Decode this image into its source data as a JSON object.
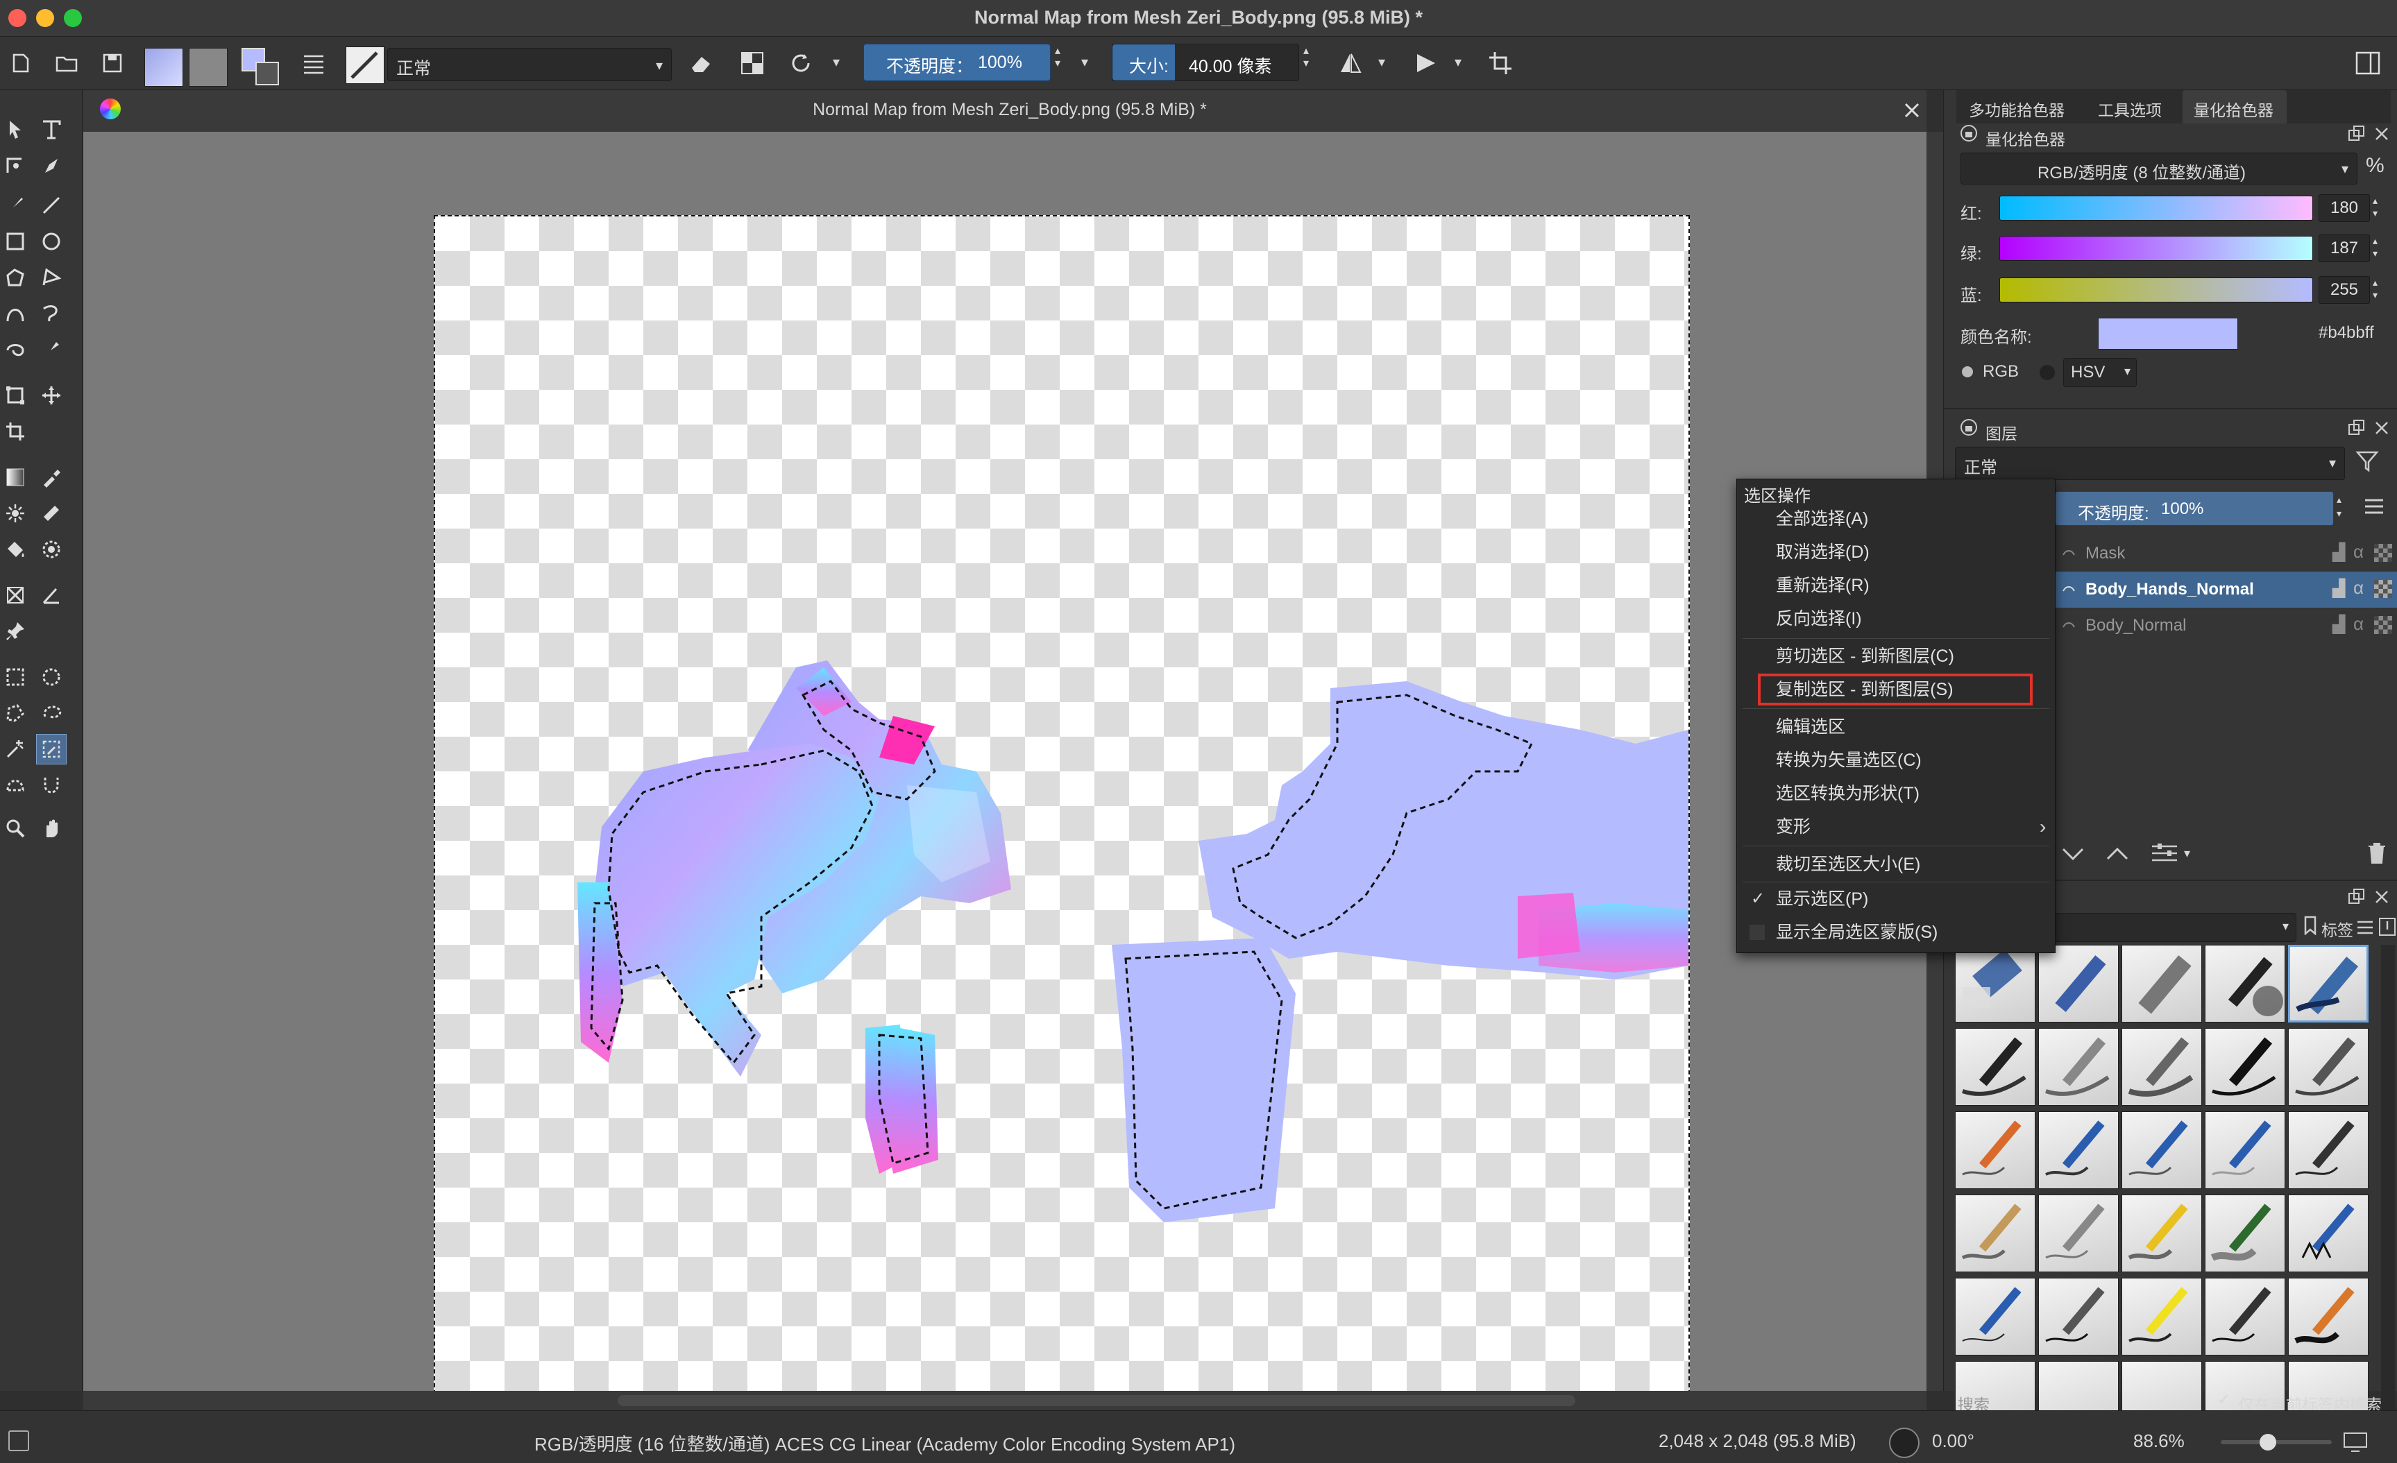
{
  "window": {
    "title": "Normal Map from Mesh Zeri_Body.png (95.8 MiB) *"
  },
  "toolbar": {
    "blend_mode": "正常",
    "opacity_label": "不透明度：",
    "opacity_value": "100%",
    "size_label": "大小:",
    "size_value": "40.00 像素"
  },
  "document_tab": {
    "title": "Normal Map from Mesh Zeri_Body.png (95.8 MiB) *"
  },
  "dock_tabs": [
    "多功能拾色器",
    "工具选项",
    "量化拾色器"
  ],
  "color_selector": {
    "title": "量化拾色器",
    "model": "RGB/透明度 (8 位整数/通道)",
    "percent_symbol": "%",
    "red_label": "红:",
    "red_value": "180",
    "green_label": "绿:",
    "green_value": "187",
    "blue_label": "蓝:",
    "blue_value": "255",
    "color_name_label": "颜色名称:",
    "hex": "#b4bbff",
    "swatch_color": "#b4bbff",
    "radio_rgb": "RGB",
    "radio_hsv": "HSV"
  },
  "layers": {
    "title": "图层",
    "blend_mode": "正常",
    "opacity_label": "不透明度:",
    "opacity_value": "100%",
    "items": [
      {
        "name": "Mask"
      },
      {
        "name": "Body_Hands_Normal"
      },
      {
        "name": "Body_Normal"
      }
    ]
  },
  "brush_presets": {
    "tag_label": "标签",
    "search_placeholder": "搜索",
    "only_current_tag": "仅在当前标签内搜索"
  },
  "context_menu": {
    "header": "选区操作",
    "items": [
      {
        "label": "全部选择(A)"
      },
      {
        "label": "取消选择(D)"
      },
      {
        "label": "重新选择(R)"
      },
      {
        "label": "反向选择(I)"
      },
      {
        "label": "剪切选区 - 到新图层(C)"
      },
      {
        "label": "复制选区 - 到新图层(S)"
      },
      {
        "label": "编辑选区"
      },
      {
        "label": "转换为矢量选区(C)"
      },
      {
        "label": "选区转换为形状(T)"
      },
      {
        "label": "变形"
      },
      {
        "label": "裁切至选区大小(E)"
      },
      {
        "label": "显示选区(P)"
      },
      {
        "label": "显示全局选区蒙版(S)"
      }
    ],
    "checkmark": "✓",
    "submenu_arrow": "›",
    "highlight_color": "#e0322a"
  },
  "status": {
    "color_space": "RGB/透明度 (16 位整数/通道)  ACES CG Linear (Academy Color Encoding System AP1)",
    "dimensions": "2,048 x 2,048 (95.8 MiB)",
    "rotation": "0.00°",
    "zoom": "88.6%"
  }
}
